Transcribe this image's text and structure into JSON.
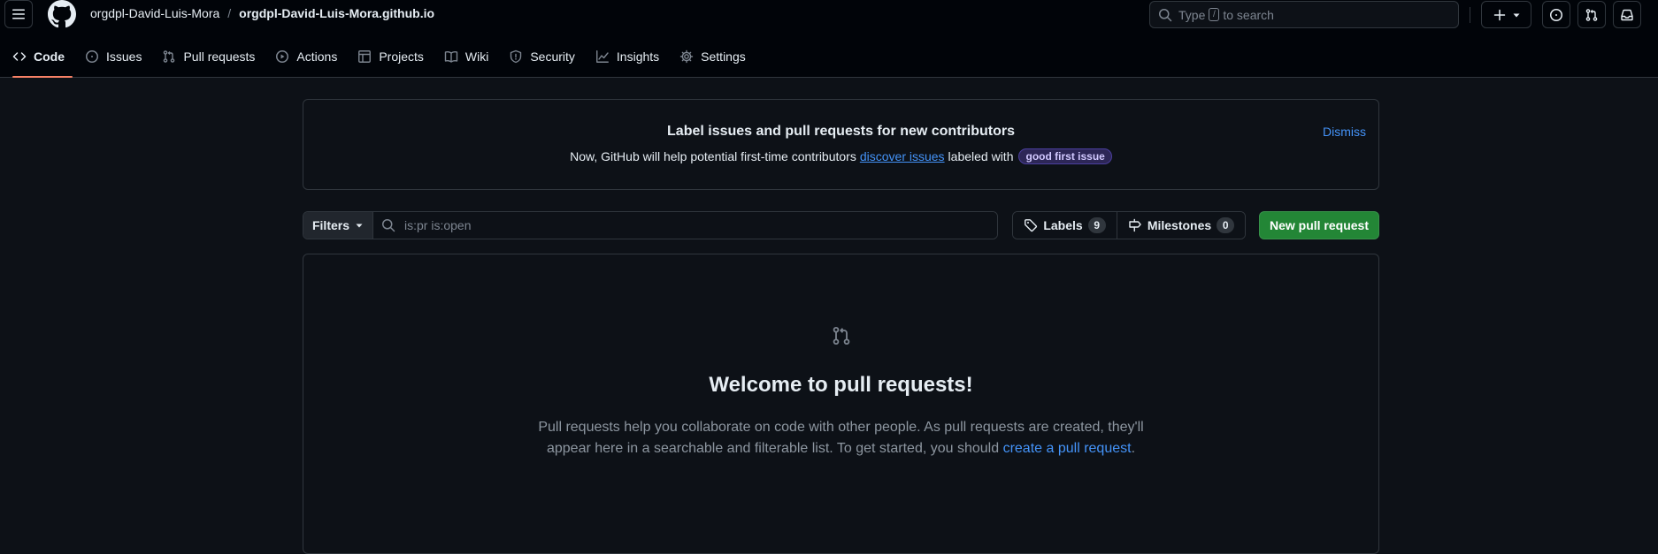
{
  "header": {
    "owner": "orgdpl-David-Luis-Mora",
    "separator": "/",
    "repo": "orgdpl-David-Luis-Mora.github.io",
    "search": {
      "prefix": "Type",
      "key": "/",
      "suffix": "to search"
    }
  },
  "nav": {
    "tabs": [
      {
        "label": "Code",
        "icon": "code-icon",
        "active": true
      },
      {
        "label": "Issues",
        "icon": "issue-opened-icon"
      },
      {
        "label": "Pull requests",
        "icon": "git-pull-request-icon"
      },
      {
        "label": "Actions",
        "icon": "play-icon"
      },
      {
        "label": "Projects",
        "icon": "table-icon"
      },
      {
        "label": "Wiki",
        "icon": "book-icon"
      },
      {
        "label": "Security",
        "icon": "shield-icon"
      },
      {
        "label": "Insights",
        "icon": "graph-icon"
      },
      {
        "label": "Settings",
        "icon": "gear-icon"
      }
    ]
  },
  "banner": {
    "title": "Label issues and pull requests for new contributors",
    "desc_before": "Now, GitHub will help potential first-time contributors",
    "desc_link": "discover issues",
    "desc_after": "labeled with",
    "label": "good first issue",
    "dismiss": "Dismiss"
  },
  "toolbar": {
    "filters": "Filters",
    "query": "is:pr is:open",
    "labels": "Labels",
    "labels_count": "9",
    "milestones": "Milestones",
    "milestones_count": "0",
    "new_pr": "New pull request"
  },
  "blank": {
    "title": "Welcome to pull requests!",
    "line1": "Pull requests help you collaborate on code with other people. As pull requests are created, they'll",
    "line2_before": "appear here in a searchable and filterable list. To get started, you should",
    "line2_link": "create a pull request",
    "line2_after": "."
  },
  "colors": {
    "accent_blue": "#4493f8",
    "primary_green": "#238636",
    "active_underline": "#f78166",
    "background": "#0d1117"
  }
}
